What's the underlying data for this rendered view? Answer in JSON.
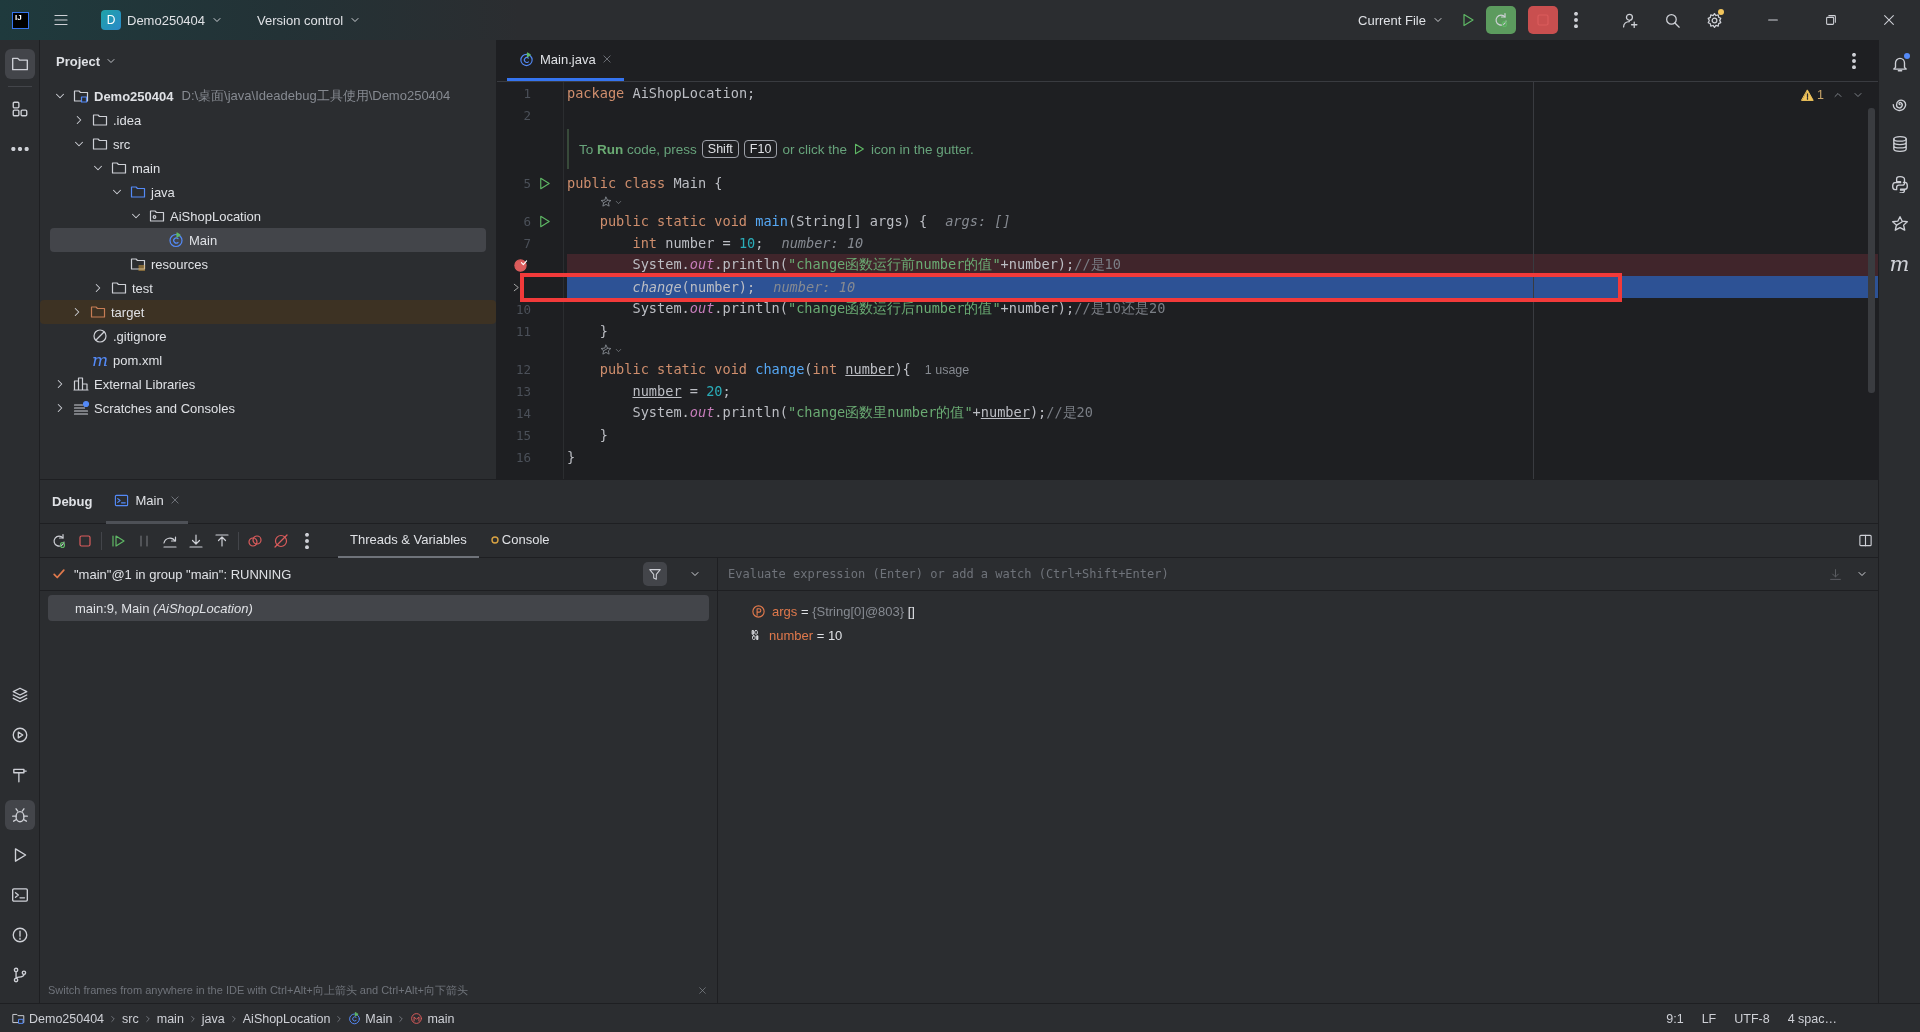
{
  "title_bar": {
    "app_logo": "IJ",
    "project_badge": "D",
    "project": "Demo250404",
    "vcs": "Version control",
    "run_config": "Current File"
  },
  "left_toolbar": {
    "top": [
      {
        "kind": "project",
        "selected": true
      },
      {
        "kind": "structure",
        "selected": false
      },
      {
        "kind": "more",
        "selected": false
      }
    ],
    "bottom": [
      {
        "kind": "layers",
        "selected": false
      },
      {
        "kind": "services",
        "selected": false
      },
      {
        "kind": "build",
        "selected": false
      },
      {
        "kind": "debug",
        "selected": true
      },
      {
        "kind": "run",
        "selected": false
      },
      {
        "kind": "terminal",
        "selected": false
      },
      {
        "kind": "problems",
        "selected": false
      },
      {
        "kind": "git",
        "selected": false
      }
    ]
  },
  "project_panel": {
    "title": "Project",
    "tree": [
      {
        "kind": "module",
        "label": "Demo250404",
        "path": "D:\\桌面\\java\\Ideadebug工具使用\\Demo250404",
        "expanded": true,
        "selected": false,
        "children": [
          {
            "kind": "folder",
            "label": ".idea",
            "expanded": false,
            "selected": false
          },
          {
            "kind": "folder",
            "label": "src",
            "expanded": true,
            "selected": false,
            "children": [
              {
                "kind": "folder",
                "label": "main",
                "expanded": true,
                "selected": false,
                "children": [
                  {
                    "kind": "source",
                    "label": "java",
                    "expanded": true,
                    "selected": false,
                    "children": [
                      {
                        "kind": "package",
                        "label": "AiShopLocation",
                        "expanded": true,
                        "selected": false,
                        "children": [
                          {
                            "kind": "class",
                            "label": "Main",
                            "selected": true
                          }
                        ]
                      }
                    ]
                  },
                  {
                    "kind": "resources",
                    "label": "resources",
                    "selected": false
                  }
                ]
              },
              {
                "kind": "folder",
                "label": "test",
                "expanded": false,
                "selected": false
              }
            ]
          },
          {
            "kind": "excluded",
            "label": "target",
            "expanded": false,
            "selected": false
          },
          {
            "kind": "gitignore",
            "label": ".gitignore",
            "selected": false
          },
          {
            "kind": "maven",
            "glyph": "m",
            "label": "pom.xml",
            "selected": false
          }
        ]
      },
      {
        "kind": "libraries",
        "label": "External Libraries",
        "expanded": false,
        "selected": false
      },
      {
        "kind": "scratches",
        "label": "Scratches and Consoles",
        "expanded": false,
        "selected": false
      }
    ]
  },
  "editor": {
    "tabs": [
      {
        "label": "Main.java",
        "selected": true
      }
    ],
    "warnings": "1",
    "lines": [
      {
        "kind": "code",
        "number": "1",
        "run": false,
        "breakpoint": false,
        "current": false,
        "tokens": [
          {
            "kind": "kw",
            "text": "package "
          },
          {
            "kind": "id",
            "text": "AiShopLocation;"
          }
        ]
      },
      {
        "kind": "code",
        "number": "2",
        "run": false,
        "breakpoint": false,
        "current": false
      },
      {
        "kind": "hint",
        "parts": [
          {
            "kind": "text",
            "text": "To **Run** code, press"
          },
          {
            "kind": "key",
            "text": "Shift"
          },
          {
            "kind": "key",
            "text": "F10"
          },
          {
            "kind": "text",
            "text": "or click the"
          },
          {
            "kind": "run-icon"
          },
          {
            "kind": "text",
            "text": "icon in the gutter."
          }
        ]
      },
      {
        "kind": "code",
        "number": "5",
        "run": true,
        "breakpoint": false,
        "current": false,
        "tokens": [
          {
            "kind": "kw",
            "text": "public class "
          },
          {
            "kind": "id",
            "text": "Main {"
          }
        ]
      },
      {
        "kind": "author"
      },
      {
        "kind": "code",
        "number": "6",
        "run": true,
        "breakpoint": false,
        "current": false,
        "tokens": [
          {
            "kind": "kw",
            "text": "    public static void "
          },
          {
            "kind": "fn",
            "text": "main"
          },
          {
            "kind": "id",
            "text": "(String[] args) {"
          },
          {
            "kind": "hint",
            "text": "args: []"
          }
        ]
      },
      {
        "kind": "code",
        "number": "7",
        "run": false,
        "breakpoint": false,
        "current": false,
        "tokens": [
          {
            "kind": "kw",
            "text": "        int "
          },
          {
            "kind": "id",
            "text": "number = "
          },
          {
            "kind": "num",
            "text": "10"
          },
          {
            "kind": "id",
            "text": ";"
          },
          {
            "kind": "hint",
            "text": "number: 10"
          }
        ]
      },
      {
        "kind": "code",
        "run": false,
        "breakpoint": true,
        "current": false,
        "tokens": [
          {
            "kind": "id",
            "text": "        System."
          },
          {
            "kind": "fld",
            "text": "out"
          },
          {
            "kind": "id",
            "text": ".println("
          },
          {
            "kind": "str",
            "text": "\"change函数运行前number的值\""
          },
          {
            "kind": "id",
            "text": "+number);"
          },
          {
            "kind": "cmt",
            "text": "//是10"
          }
        ]
      },
      {
        "kind": "code",
        "run": false,
        "breakpoint": false,
        "current": true,
        "tokens": [
          {
            "kind": "call",
            "text": "        change"
          },
          {
            "kind": "id",
            "text": "(number);"
          },
          {
            "kind": "hint",
            "text": "number: 10"
          }
        ]
      },
      {
        "kind": "code",
        "number": "10",
        "run": false,
        "breakpoint": false,
        "current": false,
        "tokens": [
          {
            "kind": "id",
            "text": "        System."
          },
          {
            "kind": "fld",
            "text": "out"
          },
          {
            "kind": "id",
            "text": ".println("
          },
          {
            "kind": "str",
            "text": "\"change函数运行后number的值\""
          },
          {
            "kind": "id",
            "text": "+number);"
          },
          {
            "kind": "cmt",
            "text": "//是10还是20"
          }
        ]
      },
      {
        "kind": "code",
        "number": "11",
        "run": false,
        "breakpoint": false,
        "current": false,
        "tokens": [
          {
            "kind": "id",
            "text": "    }"
          }
        ]
      },
      {
        "kind": "author"
      },
      {
        "kind": "code",
        "number": "12",
        "run": false,
        "breakpoint": false,
        "current": false,
        "tokens": [
          {
            "kind": "kw",
            "text": "    public static void "
          },
          {
            "kind": "fn",
            "text": "change"
          },
          {
            "kind": "id",
            "text": "("
          },
          {
            "kind": "kw",
            "text": "int "
          },
          {
            "kind": "param",
            "text": "number"
          },
          {
            "kind": "id",
            "text": "){"
          },
          {
            "kind": "usage",
            "text": "1 usage"
          }
        ]
      },
      {
        "kind": "code",
        "number": "13",
        "run": false,
        "breakpoint": false,
        "current": false,
        "tokens": [
          {
            "kind": "param",
            "text": "        number"
          },
          {
            "kind": "id",
            "text": " = "
          },
          {
            "kind": "num",
            "text": "20"
          },
          {
            "kind": "id",
            "text": ";"
          }
        ]
      },
      {
        "kind": "code",
        "number": "14",
        "run": false,
        "breakpoint": false,
        "current": false,
        "tokens": [
          {
            "kind": "id",
            "text": "        System."
          },
          {
            "kind": "fld",
            "text": "out"
          },
          {
            "kind": "id",
            "text": ".println("
          },
          {
            "kind": "str",
            "text": "\"change函数里number的值\""
          },
          {
            "kind": "id",
            "text": "+"
          },
          {
            "kind": "param",
            "text": "number"
          },
          {
            "kind": "id",
            "text": ");"
          },
          {
            "kind": "cmt",
            "text": "//是20"
          }
        ]
      },
      {
        "kind": "code",
        "number": "15",
        "run": false,
        "breakpoint": false,
        "current": false,
        "tokens": [
          {
            "kind": "id",
            "text": "    }"
          }
        ]
      },
      {
        "kind": "code",
        "number": "16",
        "run": false,
        "breakpoint": false,
        "current": false,
        "tokens": [
          {
            "kind": "id",
            "text": "}"
          }
        ]
      }
    ]
  },
  "right_toolbar": [
    {
      "kind": "notifications"
    },
    {
      "kind": "ai"
    },
    {
      "kind": "database"
    },
    {
      "kind": "python"
    },
    {
      "kind": "author"
    },
    {
      "kind": "maven",
      "glyph": "m"
    }
  ],
  "debug": {
    "title": "Debug",
    "session_tab": "Main",
    "toolbar": [
      {
        "kind": "rerun",
        "disabled": false
      },
      {
        "kind": "stop",
        "disabled": false
      },
      {
        "kind": "resume",
        "disabled": false
      },
      {
        "kind": "pause",
        "disabled": true
      },
      {
        "kind": "step-over",
        "disabled": false
      },
      {
        "kind": "step-into",
        "disabled": false
      },
      {
        "kind": "step-out",
        "disabled": false
      },
      {
        "kind": "breakpoints",
        "disabled": false
      },
      {
        "kind": "mute",
        "disabled": false
      },
      {
        "kind": "more",
        "disabled": false
      }
    ],
    "tabs": [
      {
        "label": "Threads & Variables",
        "selected": true
      },
      {
        "label": "Console",
        "selected": false
      }
    ],
    "thread": "\"main\"@1 in group \"main\": RUNNING",
    "frames": [
      {
        "text": "main:9, Main *(AiShopLocation)*",
        "selected": true
      }
    ],
    "evaluate_placeholder": "Evaluate expression (Enter) or add a watch (Ctrl+Shift+Enter)",
    "variables": [
      {
        "kind": "param",
        "name": "args",
        "operator": "=",
        "type": "{String[0]@803}",
        "value": "[]"
      },
      {
        "kind": "primitive",
        "name": "number",
        "operator": "=",
        "value": "10"
      }
    ],
    "tip": "Switch frames from anywhere in the IDE with Ctrl+Alt+向上箭头 and Ctrl+Alt+向下箭头"
  },
  "status_bar": {
    "breadcrumbs": [
      {
        "kind": "module",
        "label": "Demo250404"
      },
      {
        "kind": "folder",
        "label": "src"
      },
      {
        "kind": "folder",
        "label": "main"
      },
      {
        "kind": "folder",
        "label": "java"
      },
      {
        "kind": "folder",
        "label": "AiShopLocation"
      },
      {
        "kind": "class",
        "label": "Main"
      },
      {
        "kind": "method",
        "label": "main"
      }
    ],
    "items": [
      "9:1",
      "LF",
      "UTF-8",
      "4 spac…"
    ]
  }
}
